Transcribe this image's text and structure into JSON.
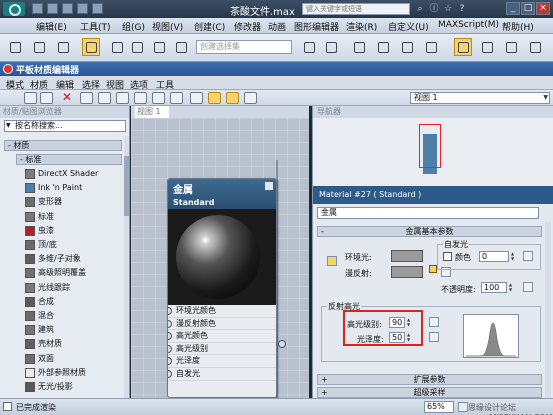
{
  "app": {
    "title": "茶酸文件.max",
    "search_placeholder": "键入关键字或短语",
    "window_buttons": [
      "_",
      "□",
      "×"
    ]
  },
  "main_menu": [
    "编辑(E)",
    "工具(T)",
    "组(G)",
    "视图(V)",
    "创建(C)",
    "修改器",
    "动画",
    "图形编辑器",
    "渲染(R)",
    "自定义(U)",
    "MAXScript(M)",
    "帮助(H)"
  ],
  "main_toolbar": {
    "selection_set_placeholder": "创建选择集"
  },
  "material_editor": {
    "title": "平板材质编辑器",
    "menu": [
      "模式",
      "材质",
      "编辑",
      "选择",
      "视图",
      "选项",
      "工具"
    ],
    "view_select": "视图 1",
    "browser": {
      "header": "材质/贴图浏览器",
      "search_placeholder": "按名称搜索...",
      "group_materials": "- 材质",
      "group_standard": "- 标准",
      "items": [
        {
          "label": "DirectX Shader",
          "swatch": "#7d7d7d"
        },
        {
          "label": "Ink 'n Paint",
          "swatch": "#4a7fb0"
        },
        {
          "label": "变形器",
          "swatch": "#6d6d6d"
        },
        {
          "label": "标准",
          "swatch": "#777777"
        },
        {
          "label": "虫漆",
          "swatch": "#b22222"
        },
        {
          "label": "顶/底",
          "swatch": "#6a6a6a"
        },
        {
          "label": "多维/子对象",
          "swatch": "#5e5e5e"
        },
        {
          "label": "高级照明覆盖",
          "swatch": "#6f6f6f"
        },
        {
          "label": "光线跟踪",
          "swatch": "#7a7a7a"
        },
        {
          "label": "合成",
          "swatch": "#5a5a5a"
        },
        {
          "label": "混合",
          "swatch": "#6b6b6b"
        },
        {
          "label": "建筑",
          "swatch": "#747474"
        },
        {
          "label": "壳材质",
          "swatch": "#626262"
        },
        {
          "label": "双面",
          "swatch": "#6c6c6c"
        },
        {
          "label": "外部参照材质",
          "swatch": "#ececec"
        },
        {
          "label": "无光/投影",
          "swatch": "#585858"
        }
      ]
    },
    "view_tab": "视图 1",
    "node": {
      "name": "金属",
      "type": "Standard",
      "slots": [
        "环境光颜色",
        "漫反射颜色",
        "高光颜色",
        "高光级别",
        "光泽度",
        "自发光"
      ]
    },
    "navigator_tab": "导航器",
    "params": {
      "header": "Material #27 ( Standard )",
      "material_name": "金属",
      "rollout_basic": "金属基本参数",
      "ambient_label": "环境光:",
      "diffuse_label": "漫反射:",
      "self_illum_label": "自发光",
      "color_label": "颜色",
      "self_illum_value": "0",
      "opacity_label": "不透明度:",
      "opacity_value": "100",
      "specular_group": "反射高光",
      "spec_level_label": "高光级别:",
      "spec_level_value": "90",
      "glossiness_label": "光泽度:",
      "glossiness_value": "50",
      "rollout_extended": "扩展参数",
      "rollout_partial": "超级采样"
    }
  },
  "status": {
    "text": "已完成渲染",
    "zoom": "65%",
    "watermark": "思缘设计论坛 www.MISSYUAN.COM"
  },
  "colors": {
    "accent_highlight": "#f7d36b",
    "params_header": "#2c5a8a",
    "highlight_box": "#dd2222"
  }
}
